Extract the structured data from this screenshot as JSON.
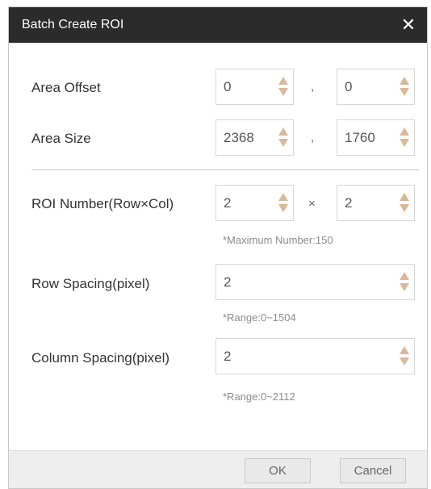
{
  "dialog": {
    "title": "Batch Create ROI",
    "close_glyph": "✕"
  },
  "area_offset": {
    "label": "Area Offset",
    "x": "0",
    "y": "0",
    "separator": ","
  },
  "area_size": {
    "label": "Area Size",
    "width": "2368",
    "height": "1760",
    "separator": ","
  },
  "roi_number": {
    "label": "ROI Number(Row×Col)",
    "rows": "2",
    "cols": "2",
    "separator": "×",
    "hint": "*Maximum Number:150"
  },
  "row_spacing": {
    "label": "Row Spacing(pixel)",
    "value": "2",
    "hint": "*Range:0~1504"
  },
  "column_spacing": {
    "label": "Column Spacing(pixel)",
    "value": "2",
    "hint": "*Range:0~2112"
  },
  "footer": {
    "ok_label": "OK",
    "cancel_label": "Cancel"
  },
  "colors": {
    "titlebar": "#2b2b2b",
    "arrow": "#d9b89b",
    "footer": "#eeeeee"
  },
  "icons": {
    "close": "close-icon",
    "spin_up": "chevron-up-icon",
    "spin_down": "chevron-down-icon"
  }
}
